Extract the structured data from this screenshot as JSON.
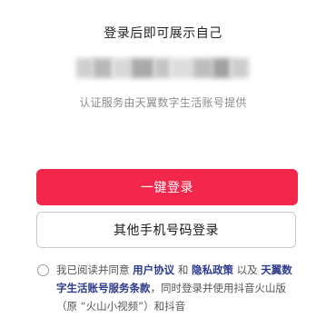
{
  "title": "登录后即可展示自己",
  "phone_number_masked": {
    "blur_colors": [
      "#cfcfcf",
      "#b8b8b8",
      "#d8d8d8",
      "#a9a9a9",
      "#c4c4c4",
      "#dcdcdc",
      "#bdbdbd",
      "#a0a0a0",
      "#cdcdcd"
    ]
  },
  "provider_note": "认证服务由天翼数字生活账号提供",
  "buttons": {
    "one_click_login": "一键登录",
    "other_phone_login": "其他手机号码登录"
  },
  "agreement": {
    "prefix": "我已阅读并同意",
    "user_agreement": "用户协议",
    "and": "和",
    "privacy_policy": "隐私政策",
    "and2": "以及",
    "provider_terms": "天翼数字生活账号服务条款",
    "suffix": "，同时登录并使用抖音火山版（原 “火山小视频”）和抖音"
  },
  "colors": {
    "primary": "#f3274c",
    "link": "#2b3a8c"
  }
}
